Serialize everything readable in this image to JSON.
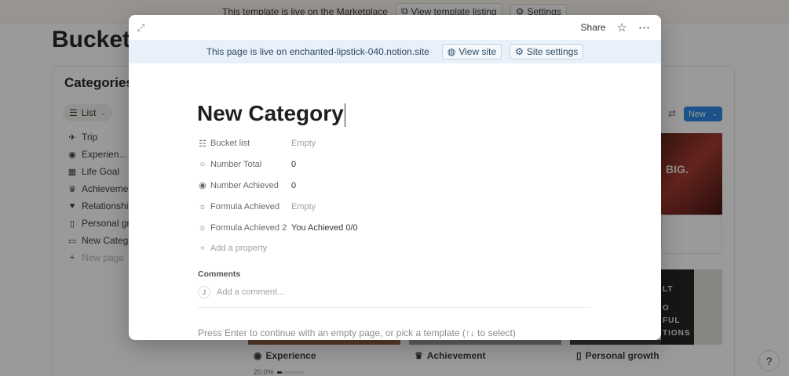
{
  "background": {
    "topbar": {
      "live_text": "This template is live on the Marketplace",
      "view_listing_label": "View template listing",
      "settings_label": "Settings"
    },
    "page_title": "Bucket",
    "database_title": "Categories",
    "view_tab_label": "List",
    "sidebar_items": [
      {
        "label": "Trip",
        "icon": "airplane-icon"
      },
      {
        "label": "Experien...",
        "icon": "compass-icon"
      },
      {
        "label": "Life Goal",
        "icon": "film-icon"
      },
      {
        "label": "Achievemen",
        "icon": "trophy-icon"
      },
      {
        "label": "Relationship",
        "icon": "heart-icon"
      },
      {
        "label": "Personal gr",
        "icon": "bookmark-icon"
      },
      {
        "label": "New Catego",
        "icon": "page-icon"
      }
    ],
    "new_page_label": "New page",
    "new_button_label": "New",
    "image_text": "BIG.",
    "book_lines": [
      "LT",
      "O",
      "FUL",
      "TIONS"
    ],
    "cards": [
      {
        "label": "Experience",
        "icon": "compass-icon"
      },
      {
        "label": "Achievement",
        "icon": "trophy-icon"
      },
      {
        "label": "Personal growth",
        "icon": "bookmark-icon"
      }
    ],
    "progress_text": "20.0%",
    "progress_value": 0.2,
    "help_label": "?"
  },
  "modal": {
    "share_label": "Share",
    "live_bar": {
      "text": "This page is live on enchanted-lipstick-040.notion.site",
      "view_site_label": "View site",
      "site_settings_label": "Site settings"
    },
    "title": "New Category",
    "properties": [
      {
        "name": "Bucket list",
        "value": "Empty",
        "empty": true,
        "icon": "relation-icon"
      },
      {
        "name": "Number Total",
        "value": "0",
        "empty": false,
        "icon": "circle-icon"
      },
      {
        "name": "Number Achieved",
        "value": "0",
        "empty": false,
        "icon": "check-circle-icon"
      },
      {
        "name": "Formula Achieved",
        "value": "Empty",
        "empty": true,
        "icon": "formula-icon"
      },
      {
        "name": "Formula Achieved 2",
        "value": "You Achieved 0/0",
        "empty": false,
        "icon": "formula-icon"
      }
    ],
    "add_property_label": "Add a property",
    "comments_heading": "Comments",
    "avatar_initial": "J",
    "comment_placeholder": "Add a comment...",
    "hint": "Press Enter to continue with an empty page, or pick a template (↑↓ to select)"
  }
}
